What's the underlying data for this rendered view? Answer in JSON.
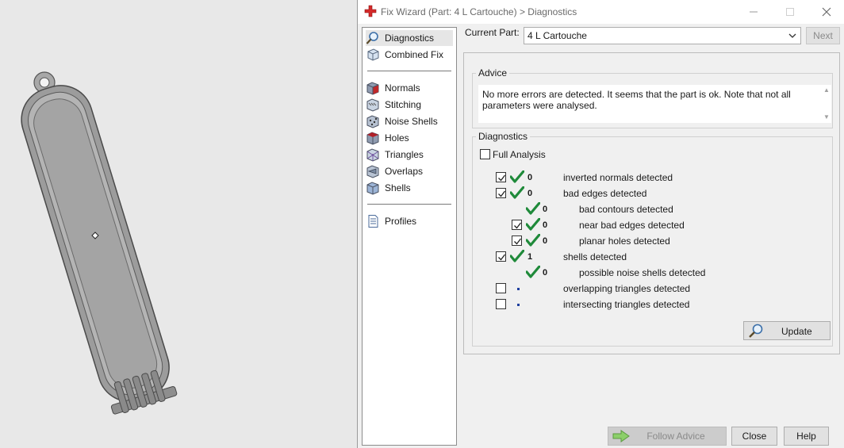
{
  "window": {
    "title": "Fix Wizard (Part: 4 L Cartouche) > Diagnostics"
  },
  "nav": {
    "items": [
      {
        "label": "Diagnostics",
        "icon": "magnifier-icon",
        "selected": true
      },
      {
        "label": "Combined Fix",
        "icon": "cube-icon"
      },
      {
        "label": "Normals",
        "icon": "normals-icon"
      },
      {
        "label": "Stitching",
        "icon": "stitching-icon"
      },
      {
        "label": "Noise Shells",
        "icon": "noise-shells-icon"
      },
      {
        "label": "Holes",
        "icon": "holes-icon"
      },
      {
        "label": "Triangles",
        "icon": "triangles-icon"
      },
      {
        "label": "Overlaps",
        "icon": "overlaps-icon"
      },
      {
        "label": "Shells",
        "icon": "shells-icon"
      },
      {
        "label": "Profiles",
        "icon": "profiles-icon"
      }
    ]
  },
  "part": {
    "label": "Current Part:",
    "value": "4 L Cartouche",
    "next_label": "Next"
  },
  "advice": {
    "title": "Advice",
    "text": "No more errors are detected. It seems that the part is ok. Note that not all parameters were analysed."
  },
  "diagnostics": {
    "title": "Diagnostics",
    "full_analysis_label": "Full Analysis",
    "full_analysis_checked": false,
    "rows": [
      {
        "checkbox": true,
        "checked": true,
        "status": "ok",
        "count": "0",
        "label": "inverted normals detected"
      },
      {
        "checkbox": true,
        "checked": true,
        "status": "ok",
        "count": "0",
        "label": "bad edges detected"
      },
      {
        "checkbox": false,
        "status": "ok",
        "count": "0",
        "label": "bad contours detected"
      },
      {
        "checkbox": true,
        "checked": true,
        "status": "ok",
        "count": "0",
        "label": "near bad edges detected"
      },
      {
        "checkbox": true,
        "checked": true,
        "status": "ok",
        "count": "0",
        "label": "planar holes detected"
      },
      {
        "checkbox": true,
        "checked": true,
        "status": "ok",
        "count": "1",
        "label": "shells detected"
      },
      {
        "checkbox": false,
        "status": "ok",
        "count": "0",
        "label": "possible noise shells detected"
      },
      {
        "checkbox": true,
        "checked": false,
        "status": "pending",
        "count": "",
        "label": "overlapping triangles detected"
      },
      {
        "checkbox": true,
        "checked": false,
        "status": "pending",
        "count": "",
        "label": "intersecting triangles detected"
      }
    ],
    "update_label": "Update"
  },
  "buttons": {
    "follow_advice": "Follow Advice",
    "close": "Close",
    "help": "Help"
  },
  "colors": {
    "check_green": "#1f8a3a",
    "pending_dot": "#1e3f9e",
    "part_gray": "#9a9a9a"
  }
}
